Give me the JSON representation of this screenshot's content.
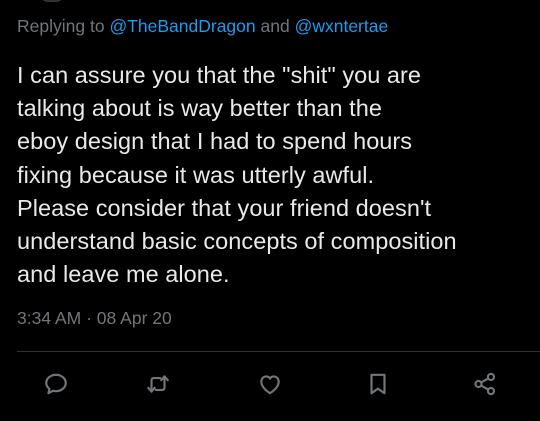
{
  "reply_header": {
    "prefix": "Replying to",
    "mention_1": "@TheBandDragon",
    "conjunction": "and",
    "mention_2": "@wxntertae"
  },
  "tweet": {
    "text": "I can assure you that the \"shit\" you are\ntalking about is way better than the\neboy design that I had to spend hours\nfixing because it was utterly awful.\nPlease consider that your friend doesn't\nunderstand basic concepts of composition\nand leave me alone.",
    "time": "3:34 AM",
    "separator": "·",
    "date": "08 Apr 20"
  },
  "actions": [
    {
      "name": "reply",
      "icon": "reply-bubble-icon"
    },
    {
      "name": "retweet",
      "icon": "retweet-arrows-icon"
    },
    {
      "name": "like",
      "icon": "heart-icon"
    },
    {
      "name": "bookmark",
      "icon": "bookmark-icon"
    },
    {
      "name": "share",
      "icon": "share-nodes-icon"
    }
  ],
  "colors": {
    "background": "#000000",
    "text": "#e7e9ea",
    "secondary": "#71767b",
    "link": "#1d9bf0",
    "divider": "#2f3336"
  }
}
